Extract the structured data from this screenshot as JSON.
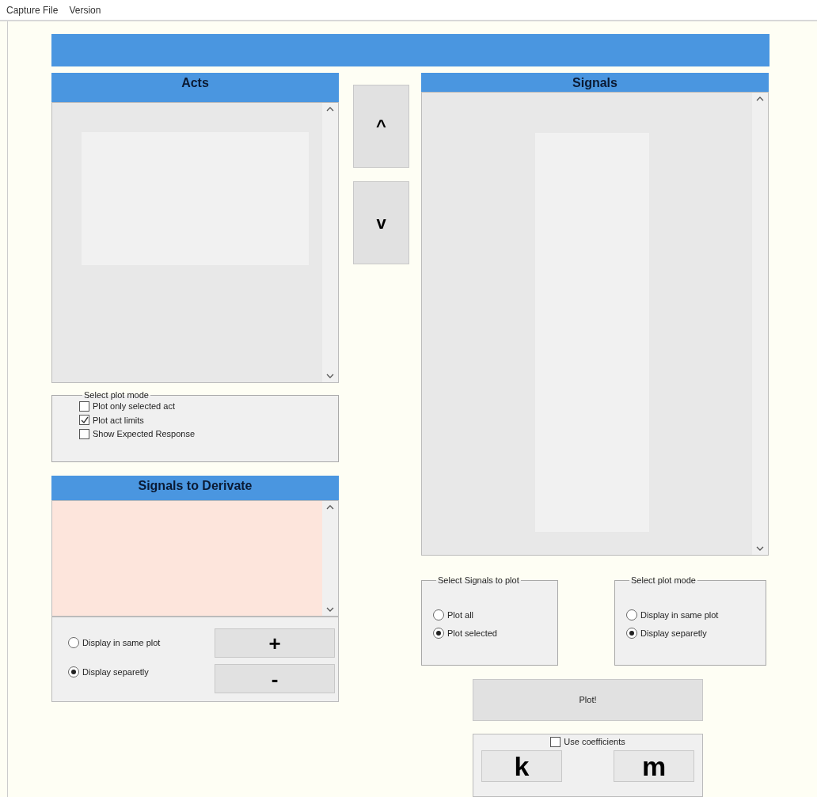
{
  "menu": [
    "Capture File",
    "Version"
  ],
  "acts": {
    "title": "Acts"
  },
  "act_plot_mode": {
    "legend": "Select plot mode",
    "options": [
      {
        "label": "Plot only selected act",
        "checked": false
      },
      {
        "label": "Plot act limits",
        "checked": true
      },
      {
        "label": "Show Expected Response",
        "checked": false
      }
    ]
  },
  "derivate": {
    "title": "Signals to Derivate",
    "options": [
      {
        "label": "Display in same plot",
        "selected": false
      },
      {
        "label": "Display separetly",
        "selected": true
      }
    ],
    "buttons": [
      "+",
      "-"
    ]
  },
  "move_buttons": [
    "^",
    "v"
  ],
  "signals": {
    "title": "Signals"
  },
  "signal_select": {
    "legend": "Select Signals to plot",
    "options": [
      {
        "label": "Plot all",
        "selected": false
      },
      {
        "label": "Plot selected",
        "selected": true
      }
    ]
  },
  "signal_plot_mode": {
    "legend": "Select plot mode",
    "options": [
      {
        "label": "Display in same plot",
        "selected": false
      },
      {
        "label": "Display separetly",
        "selected": true
      }
    ]
  },
  "plot_button": "Plot!",
  "coefficients": {
    "label": "Use coefficients",
    "checked": false,
    "buttons": [
      "k",
      "m"
    ]
  }
}
